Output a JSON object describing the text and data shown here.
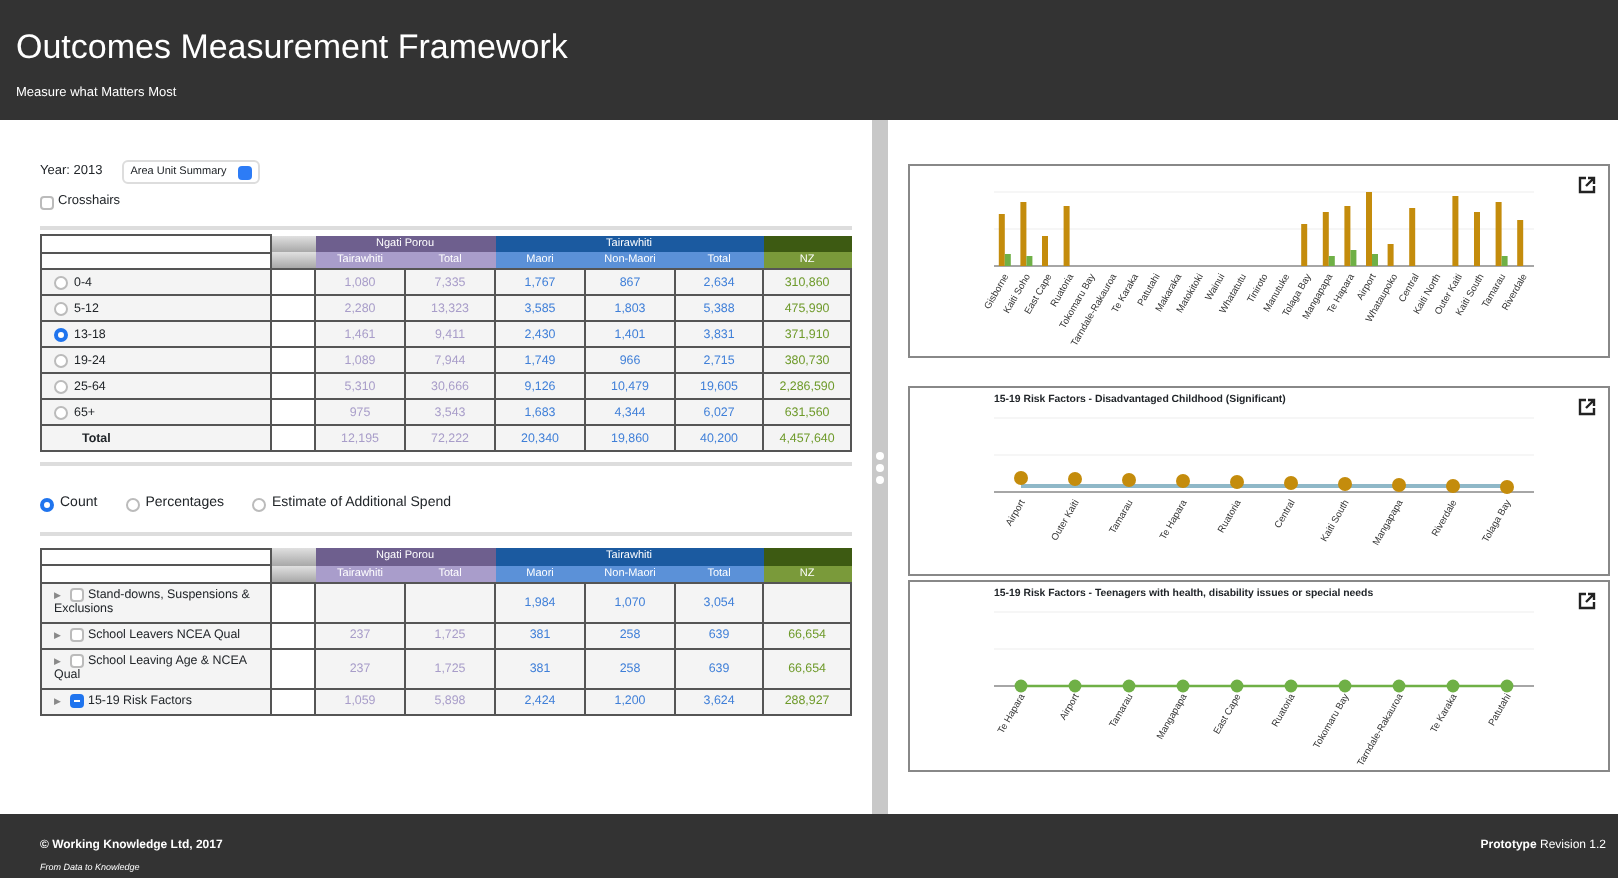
{
  "header": {
    "title": "Outcomes Measurement Framework",
    "subtitle": "Measure what Matters Most"
  },
  "controls": {
    "year_label": "Year: 2013",
    "select_value": "Area Unit Summary",
    "crosshairs": {
      "label": "Crosshairs",
      "checked": false
    }
  },
  "age_table": {
    "group_headers": [
      {
        "label": "Ngati Porou",
        "kind": "np"
      },
      {
        "label": "Tairawhiti",
        "kind": "tw"
      },
      {
        "kind": "nz"
      }
    ],
    "columns": [
      {
        "label": "Tairawhiti",
        "kind": "np"
      },
      {
        "label": "Total",
        "kind": "np"
      },
      {
        "label": "Maori",
        "kind": "tw"
      },
      {
        "label": "Non-Maori",
        "kind": "tw"
      },
      {
        "label": "Total",
        "kind": "tw"
      },
      {
        "label": "NZ",
        "kind": "nz"
      }
    ],
    "rows": [
      {
        "label": "0-4",
        "selected": false,
        "cells": [
          "1,080",
          "7,335",
          "1,767",
          "867",
          "2,634",
          "310,860"
        ]
      },
      {
        "label": "5-12",
        "selected": false,
        "cells": [
          "2,280",
          "13,323",
          "3,585",
          "1,803",
          "5,388",
          "475,990"
        ]
      },
      {
        "label": "13-18",
        "selected": true,
        "cells": [
          "1,461",
          "9,411",
          "2,430",
          "1,401",
          "3,831",
          "371,910"
        ]
      },
      {
        "label": "19-24",
        "selected": false,
        "cells": [
          "1,089",
          "7,944",
          "1,749",
          "966",
          "2,715",
          "380,730"
        ]
      },
      {
        "label": "25-64",
        "selected": false,
        "cells": [
          "5,310",
          "30,666",
          "9,126",
          "10,479",
          "19,605",
          "2,286,590"
        ]
      },
      {
        "label": "65+",
        "selected": false,
        "cells": [
          "975",
          "3,543",
          "1,683",
          "4,344",
          "6,027",
          "631,560"
        ]
      }
    ],
    "total_row": {
      "label": "Total",
      "cells": [
        "12,195",
        "72,222",
        "20,340",
        "19,860",
        "40,200",
        "4,457,640"
      ]
    }
  },
  "modes": [
    {
      "label": "Count",
      "selected": true
    },
    {
      "label": "Percentages",
      "selected": false
    },
    {
      "label": "Estimate of Additional Spend",
      "selected": false
    }
  ],
  "factor_table": {
    "group_headers": [
      {
        "label": "Ngati Porou",
        "kind": "np"
      },
      {
        "label": "Tairawhiti",
        "kind": "tw"
      },
      {
        "kind": "nz"
      }
    ],
    "columns": [
      {
        "label": "Tairawhiti",
        "kind": "np"
      },
      {
        "label": "Total",
        "kind": "np"
      },
      {
        "label": "Maori",
        "kind": "tw"
      },
      {
        "label": "Non-Maori",
        "kind": "tw"
      },
      {
        "label": "Total",
        "kind": "tw"
      },
      {
        "label": "NZ",
        "kind": "nz"
      }
    ],
    "rows": [
      {
        "label": "Stand-downs, Suspensions & Exclusions",
        "expand_glyph": "▶",
        "indeterminate": false,
        "cells": [
          null,
          null,
          "1,984",
          "1,070",
          "3,054",
          null
        ]
      },
      {
        "label": "School Leavers NCEA Qual",
        "expand_glyph": "▶",
        "indeterminate": false,
        "cells": [
          "237",
          "1,725",
          "381",
          "258",
          "639",
          "66,654"
        ]
      },
      {
        "label": "School Leaving Age & NCEA Qual",
        "expand_glyph": "▶",
        "indeterminate": false,
        "cells": [
          "237",
          "1,725",
          "381",
          "258",
          "639",
          "66,654"
        ]
      },
      {
        "label": "15-19 Risk Factors",
        "expand_glyph": "▶",
        "indeterminate": true,
        "cells": [
          "1,059",
          "5,898",
          "2,424",
          "1,200",
          "3,624",
          "288,927"
        ]
      }
    ]
  },
  "charts": [
    {
      "kind": "bars",
      "categories": [
        "Gisborne",
        "Kaiti Soho",
        "East Cape",
        "Ruatoria",
        "Tokomaru Bay",
        "Tarndale-Rakauroa",
        "Te Karaka",
        "Patutahi",
        "Makaraka",
        "Matokitoki",
        "Wainui",
        "Whatatutu",
        "Tiniroto",
        "Manutuke",
        "Tolaga Bay",
        "Mangapapa",
        "Te Hapara",
        "Airport",
        "Whataupoko",
        "Central",
        "Kaiti North",
        "Outer Kaiti",
        "Kaiti South",
        "Tamarau",
        "Riverdale"
      ]
    },
    {
      "kind": "gold-dots",
      "title": "15-19 Risk Factors - Disadvantaged Childhood (Significant)",
      "categories": [
        "Airport",
        "Outer Kaiti",
        "Tamarau",
        "Te Hapara",
        "Ruatoria",
        "Central",
        "Kaiti South",
        "Mangapapa",
        "Riverdale",
        "Tolaga Bay"
      ]
    },
    {
      "kind": "green-dots",
      "title": "15-19 Risk Factors - Teenagers with health, disability issues or special needs",
      "categories": [
        "Te Hapara",
        "Airport",
        "Tamarau",
        "Mangapapa",
        "East Cape",
        "Ruatoria",
        "Tokomaru Bay",
        "Tarndale-Rakauroa",
        "Te Karaka",
        "Patutahi"
      ]
    }
  ],
  "footer": {
    "copyright": "© Working Knowledge Ltd, 2017",
    "tagline": "From Data to Knowledge",
    "prototype": "Prototype",
    "revision": "Revision 1.2"
  }
}
